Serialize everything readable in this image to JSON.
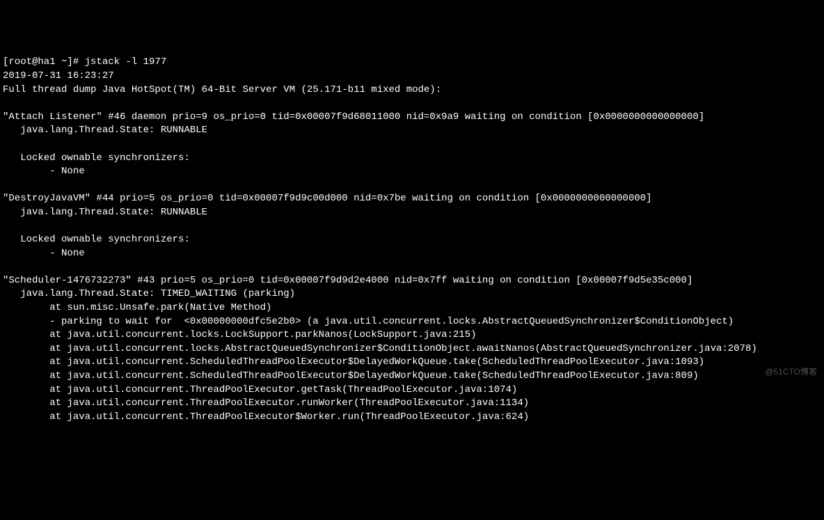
{
  "terminal": {
    "line01": "[root@ha1 ~]# jstack -l 1977",
    "line02": "2019-07-31 16:23:27",
    "line03": "Full thread dump Java HotSpot(TM) 64-Bit Server VM (25.171-b11 mixed mode):",
    "line04": "",
    "line05": "\"Attach Listener\" #46 daemon prio=9 os_prio=0 tid=0x00007f9d68011000 nid=0x9a9 waiting on condition [0x0000000000000000]",
    "line06": "   java.lang.Thread.State: RUNNABLE",
    "line07": "",
    "line08": "   Locked ownable synchronizers:",
    "line09": "        - None",
    "line10": "",
    "line11": "\"DestroyJavaVM\" #44 prio=5 os_prio=0 tid=0x00007f9d9c00d000 nid=0x7be waiting on condition [0x0000000000000000]",
    "line12": "   java.lang.Thread.State: RUNNABLE",
    "line13": "",
    "line14": "   Locked ownable synchronizers:",
    "line15": "        - None",
    "line16": "",
    "line17": "\"Scheduler-1476732273\" #43 prio=5 os_prio=0 tid=0x00007f9d9d2e4000 nid=0x7ff waiting on condition [0x00007f9d5e35c000]",
    "line18": "   java.lang.Thread.State: TIMED_WAITING (parking)",
    "line19": "        at sun.misc.Unsafe.park(Native Method)",
    "line20": "        - parking to wait for  <0x00000000dfc5e2b0> (a java.util.concurrent.locks.AbstractQueuedSynchronizer$ConditionObject)",
    "line21": "        at java.util.concurrent.locks.LockSupport.parkNanos(LockSupport.java:215)",
    "line22": "        at java.util.concurrent.locks.AbstractQueuedSynchronizer$ConditionObject.awaitNanos(AbstractQueuedSynchronizer.java:2078)",
    "line23": "        at java.util.concurrent.ScheduledThreadPoolExecutor$DelayedWorkQueue.take(ScheduledThreadPoolExecutor.java:1093)",
    "line24": "        at java.util.concurrent.ScheduledThreadPoolExecutor$DelayedWorkQueue.take(ScheduledThreadPoolExecutor.java:809)",
    "line25": "        at java.util.concurrent.ThreadPoolExecutor.getTask(ThreadPoolExecutor.java:1074)",
    "line26": "        at java.util.concurrent.ThreadPoolExecutor.runWorker(ThreadPoolExecutor.java:1134)",
    "line27": "        at java.util.concurrent.ThreadPoolExecutor$Worker.run(ThreadPoolExecutor.java:624)"
  },
  "watermark": "@51CTO博客"
}
